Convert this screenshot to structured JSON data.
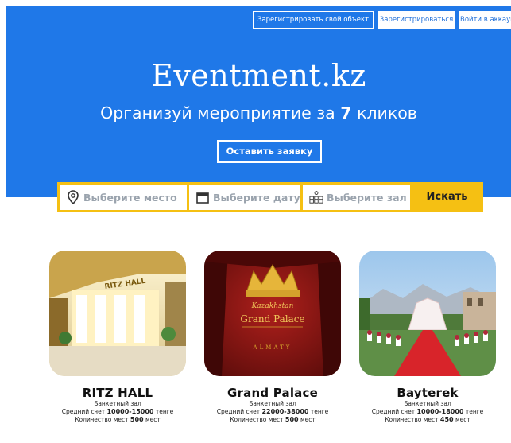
{
  "header": {
    "register_object": "Зарегистрировать свой объект",
    "register": "Зарегистрироваться",
    "login": "Войти в аккаунт"
  },
  "hero": {
    "brand": "Eventment.kz",
    "tagline_prefix": "Организуй мероприятие за",
    "tagline_number": "7",
    "tagline_suffix": "кликов",
    "cta": "Оставить заявку"
  },
  "search": {
    "place_placeholder": "Выберите место",
    "date_placeholder": "Выберите дату",
    "hall_placeholder": "Выберите зал",
    "button": "Искать",
    "icons": [
      "map-pin-icon",
      "calendar-icon",
      "hall-icon"
    ]
  },
  "venues": [
    {
      "name": "RITZ HALL",
      "type": "Банкетный зал",
      "check_label": "Средний счет",
      "check_range": "10000-15000",
      "currency": "тенге",
      "seats_label": "Количество мест",
      "seats": "500",
      "seats_unit": "мест",
      "photo_sign": "RITZ HALL"
    },
    {
      "name": "Grand Palace",
      "type": "Банкетный зал",
      "check_label": "Средний счет",
      "check_range": "22000-38000",
      "currency": "тенге",
      "seats_label": "Количество мест",
      "seats": "500",
      "seats_unit": "мест",
      "photo_line1": "Kazakhstan",
      "photo_line2": "Grand Palace",
      "photo_line3": "ALMATY"
    },
    {
      "name": "Bayterek",
      "type": "Банкетный зал",
      "check_label": "Средний счет",
      "check_range": "10000-18000",
      "currency": "тенге",
      "seats_label": "Количество мест",
      "seats": "450",
      "seats_unit": "мест"
    }
  ],
  "colors": {
    "hero_blue": "#1f78e8",
    "search_yellow": "#f5c013",
    "placeholder_gray": "#9aa3ad"
  }
}
